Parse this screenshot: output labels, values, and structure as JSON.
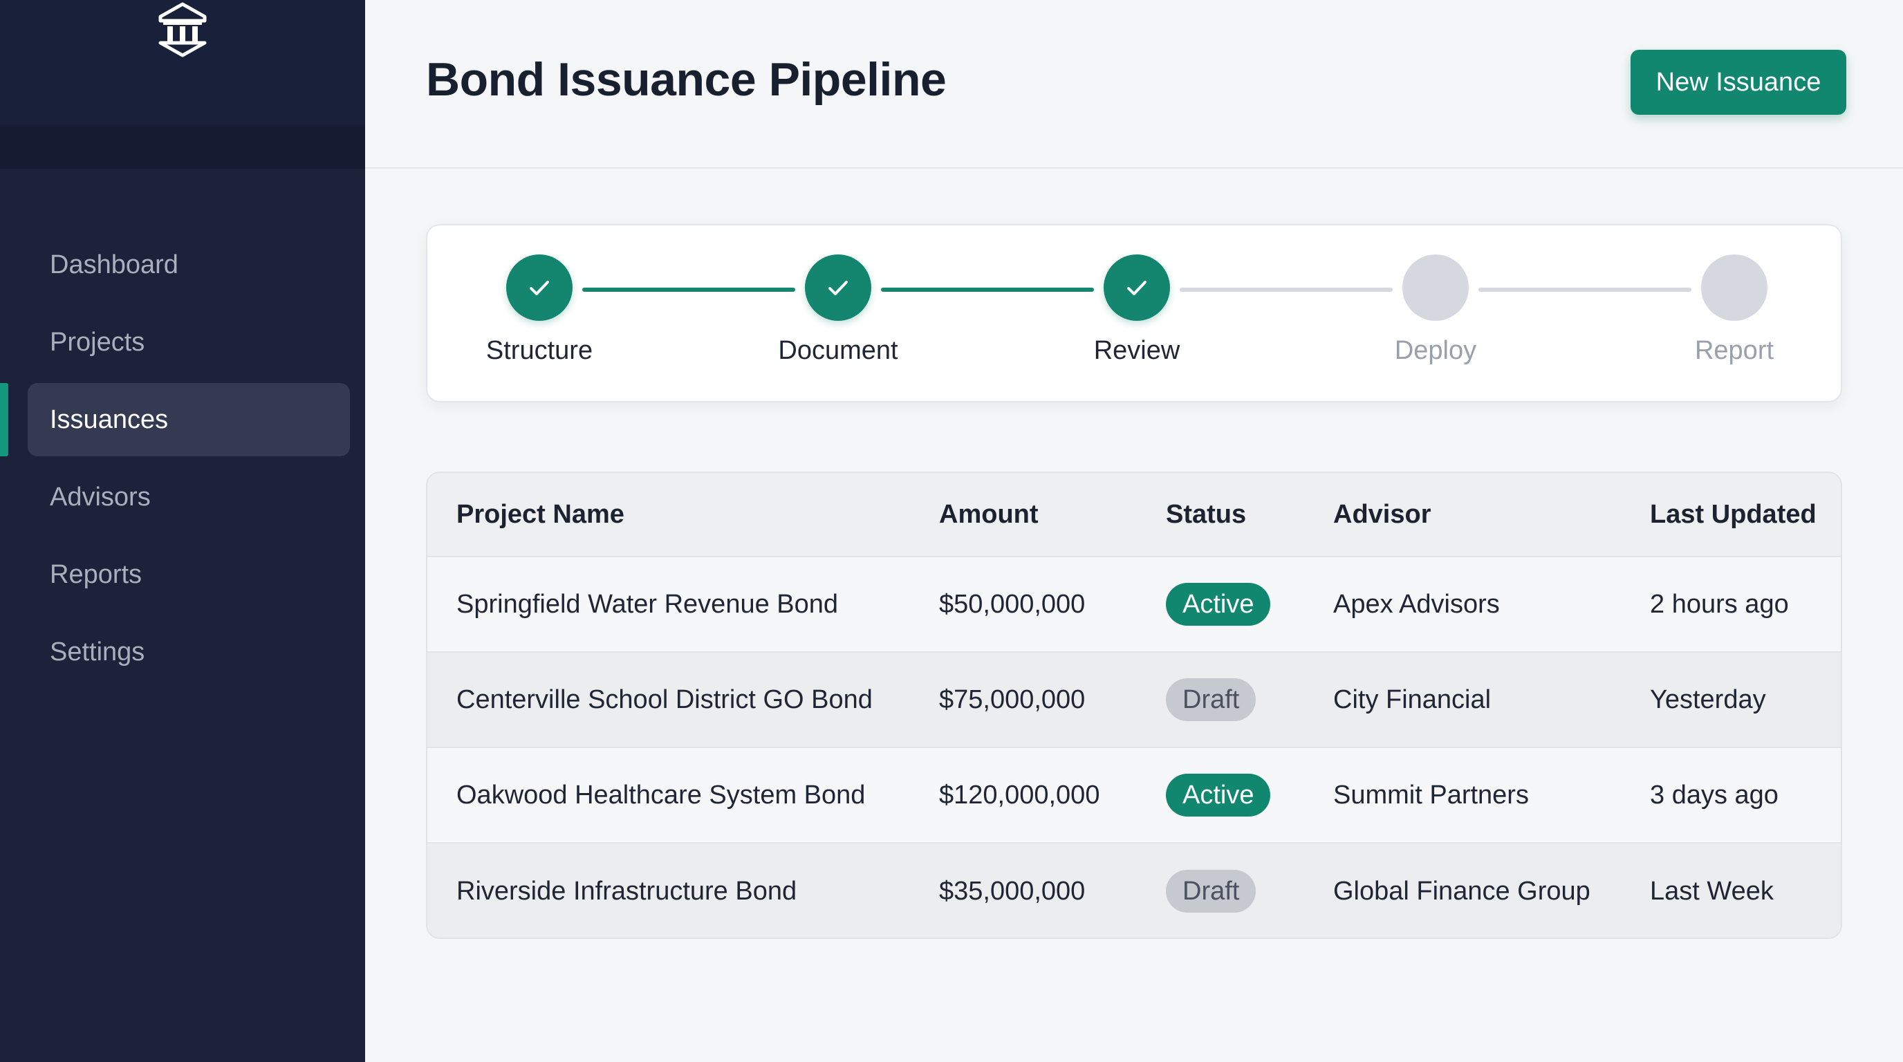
{
  "sidebar": {
    "logo_icon": "bank-building-icon",
    "items": [
      {
        "label": "Dashboard",
        "active": false
      },
      {
        "label": "Projects",
        "active": false
      },
      {
        "label": "Issuances",
        "active": true
      },
      {
        "label": "Advisors",
        "active": false
      },
      {
        "label": "Reports",
        "active": false
      },
      {
        "label": "Settings",
        "active": false
      }
    ]
  },
  "header": {
    "title": "Bond Issuance Pipeline",
    "new_button_label": "New Issuance"
  },
  "stepper": {
    "steps": [
      {
        "label": "Structure",
        "status": "complete"
      },
      {
        "label": "Document",
        "status": "complete"
      },
      {
        "label": "Review",
        "status": "complete"
      },
      {
        "label": "Deploy",
        "status": "pending"
      },
      {
        "label": "Report",
        "status": "pending"
      }
    ]
  },
  "table": {
    "columns": [
      "Project Name",
      "Amount",
      "Status",
      "Advisor",
      "Last Updated"
    ],
    "rows": [
      {
        "project": "Springfield Water Revenue Bond",
        "amount": "$50,000,000",
        "status": "Active",
        "advisor": "Apex Advisors",
        "updated": "2 hours ago"
      },
      {
        "project": "Centerville School District GO Bond",
        "amount": "$75,000,000",
        "status": "Draft",
        "advisor": "City Financial",
        "updated": "Yesterday"
      },
      {
        "project": "Oakwood Healthcare System Bond",
        "amount": "$120,000,000",
        "status": "Active",
        "advisor": "Summit Partners",
        "updated": "3 days ago"
      },
      {
        "project": "Riverside Infrastructure Bond",
        "amount": "$35,000,000",
        "status": "Draft",
        "advisor": "Global Finance Group",
        "updated": "Last Week"
      }
    ]
  },
  "colors": {
    "accent": "#12876f",
    "sidebar_bg": "#1b2239",
    "page_bg": "#f5f6f7",
    "draft_badge": "#c6c9d0"
  }
}
